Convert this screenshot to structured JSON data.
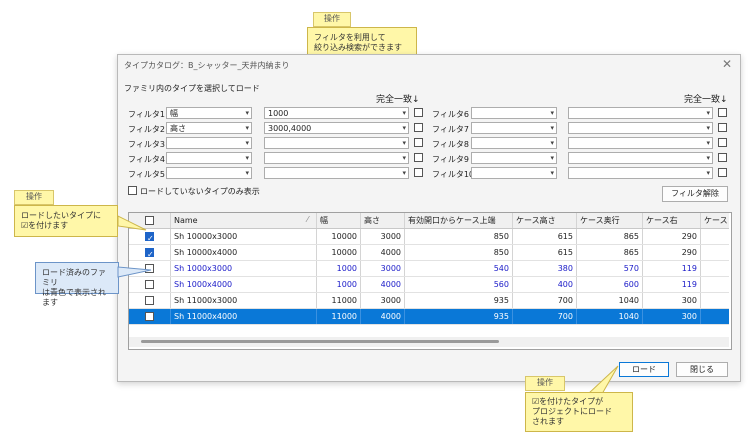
{
  "callout_top": {
    "badge": "操作",
    "text": [
      "フィルタを利用して",
      "絞り込み検索ができます"
    ]
  },
  "callout_left": {
    "badge": "操作",
    "text": [
      "ロードしたいタイプに",
      "☑を付けます"
    ]
  },
  "callout_blue": {
    "text": [
      "ロード済みのファミリ",
      "は青色で表示されます"
    ]
  },
  "callout_bottom": {
    "badge": "操作",
    "text": [
      "☑を付けたタイプが",
      "プロジェクトにロード",
      "されます"
    ]
  },
  "dialog": {
    "title": "タイプカタログ：B_シャッター_天井内納まり",
    "section_label": "ファミリ内のタイプを選択してロード",
    "exact_match_left": "完全一致↓",
    "exact_match_right": "完全一致↓",
    "filters_left": [
      {
        "label": "フィルタ1",
        "field": "幅",
        "value": "1000"
      },
      {
        "label": "フィルタ2",
        "field": "高さ",
        "value": "3000,4000"
      },
      {
        "label": "フィルタ3",
        "field": "",
        "value": ""
      },
      {
        "label": "フィルタ4",
        "field": "",
        "value": ""
      },
      {
        "label": "フィルタ5",
        "field": "",
        "value": ""
      }
    ],
    "filters_right": [
      {
        "label": "フィルタ6",
        "field": "",
        "value": ""
      },
      {
        "label": "フィルタ7",
        "field": "",
        "value": ""
      },
      {
        "label": "フィルタ8",
        "field": "",
        "value": ""
      },
      {
        "label": "フィルタ9",
        "field": "",
        "value": ""
      },
      {
        "label": "フィルタ10",
        "field": "",
        "value": ""
      }
    ],
    "only_unloaded_label": "ロードしていないタイプのみ表示",
    "clear_filter_button": "フィルタ解除",
    "load_button": "ロード",
    "close_button": "閉じる",
    "grid": {
      "columns": [
        "Name",
        "幅",
        "高さ",
        "有効開口からケース上端",
        "ケース高さ",
        "ケース奥行",
        "ケース右",
        "ケース"
      ],
      "rows": [
        {
          "checked": true,
          "loaded": false,
          "selected": false,
          "cells": [
            "Sh 10000x3000",
            "10000",
            "3000",
            "850",
            "615",
            "865",
            "290"
          ]
        },
        {
          "checked": true,
          "loaded": false,
          "selected": false,
          "cells": [
            "Sh 10000x4000",
            "10000",
            "4000",
            "850",
            "615",
            "865",
            "290"
          ]
        },
        {
          "checked": false,
          "loaded": true,
          "selected": false,
          "cells": [
            "Sh 1000x3000",
            "1000",
            "3000",
            "540",
            "380",
            "570",
            "119"
          ]
        },
        {
          "checked": false,
          "loaded": true,
          "selected": false,
          "cells": [
            "Sh 1000x4000",
            "1000",
            "4000",
            "560",
            "400",
            "600",
            "119"
          ]
        },
        {
          "checked": false,
          "loaded": false,
          "selected": false,
          "cells": [
            "Sh 11000x3000",
            "11000",
            "3000",
            "935",
            "700",
            "1040",
            "300"
          ]
        },
        {
          "checked": false,
          "loaded": false,
          "selected": true,
          "cells": [
            "Sh 11000x4000",
            "11000",
            "4000",
            "935",
            "700",
            "1040",
            "300"
          ]
        }
      ]
    }
  }
}
